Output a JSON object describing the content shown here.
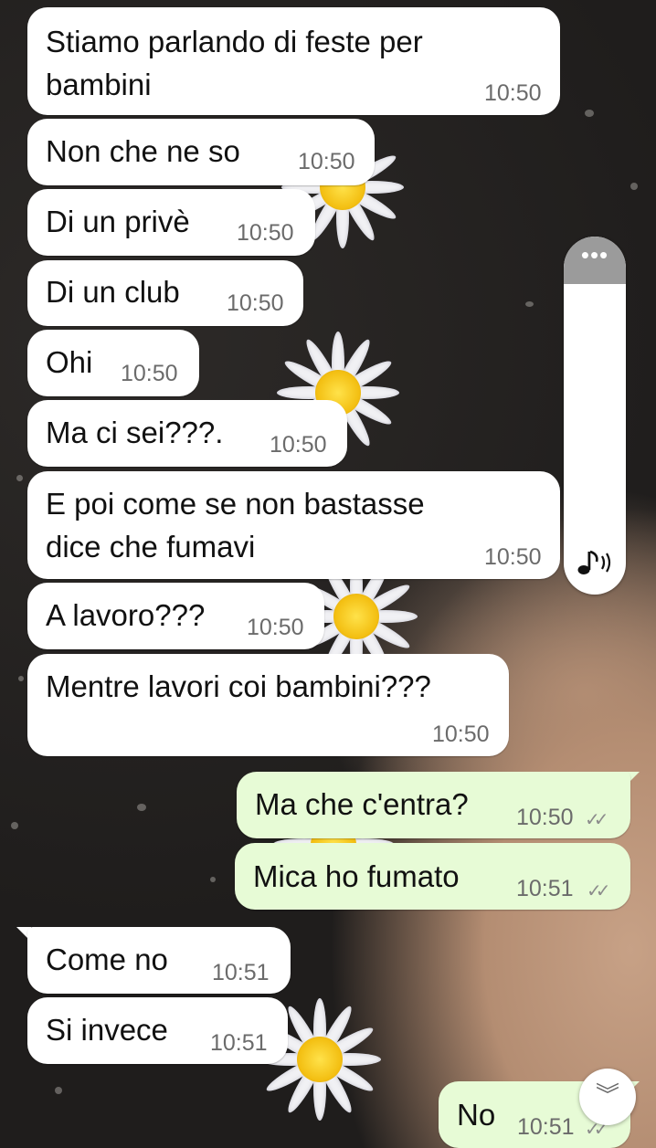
{
  "messages": [
    {
      "text": "Stiamo parlando di feste per\nbambini",
      "time": "10:50"
    },
    {
      "text": "Non che ne so",
      "time": "10:50"
    },
    {
      "text": "Di un privè",
      "time": "10:50"
    },
    {
      "text": "Di un club",
      "time": "10:50"
    },
    {
      "text": "Ohi",
      "time": "10:50"
    },
    {
      "text": "Ma ci sei???.",
      "time": "10:50"
    },
    {
      "text": "E poi come se non bastasse\ndice che fumavi",
      "time": "10:50"
    },
    {
      "text": "A lavoro???",
      "time": "10:50"
    },
    {
      "text": "Mentre lavori coi bambini???",
      "time": "10:50"
    },
    {
      "text": "Ma che c'entra?",
      "time": "10:50",
      "status": "✓✓"
    },
    {
      "text": "Mica ho fumato",
      "time": "10:51",
      "status": "✓✓"
    },
    {
      "text": "Come no",
      "time": "10:51"
    },
    {
      "text": "Si invece",
      "time": "10:51"
    },
    {
      "text": "No",
      "time": "10:51",
      "status": "✓✓"
    }
  ],
  "scroller": {
    "handle": "•••",
    "icon": "audio-icon"
  },
  "scroll_down": {
    "icon": "double-chevron-down-icon",
    "glyph": "︾"
  },
  "colors": {
    "incoming": "#ffffff",
    "outgoing": "#e7fbd6"
  }
}
